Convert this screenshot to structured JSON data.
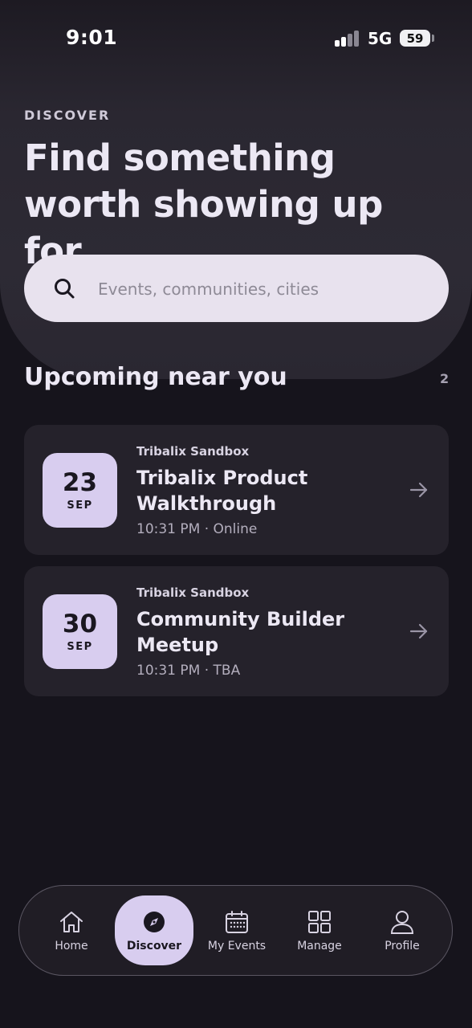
{
  "status_bar": {
    "time": "9:01",
    "network": "5G",
    "battery": "59"
  },
  "hero": {
    "eyebrow": "DISCOVER",
    "headline": "Find something worth showing up for.",
    "search": {
      "placeholder": "Events, communities, cities",
      "value": "",
      "icon": "search-icon"
    }
  },
  "upcoming": {
    "title": "Upcoming near you",
    "count": "2",
    "events": [
      {
        "day": "23",
        "month": "SEP",
        "organizer": "Tribalix Sandbox",
        "title": "Tribalix Product Walkthrough",
        "meta": "10:31 PM · Online"
      },
      {
        "day": "30",
        "month": "SEP",
        "organizer": "Tribalix Sandbox",
        "title": "Community Builder Meetup",
        "meta": "10:31 PM · TBA"
      }
    ]
  },
  "nav": {
    "items": [
      {
        "label": "Home",
        "icon": "home-icon",
        "active": false
      },
      {
        "label": "Discover",
        "icon": "compass-icon",
        "active": true
      },
      {
        "label": "My Events",
        "icon": "calendar-icon",
        "active": false
      },
      {
        "label": "Manage",
        "icon": "grid-icon",
        "active": false
      },
      {
        "label": "Profile",
        "icon": "person-icon",
        "active": false
      }
    ]
  },
  "colors": {
    "background": "#16141c",
    "accent": "#d8cdef",
    "card": "#25222b",
    "search": "#e8e2ee"
  }
}
